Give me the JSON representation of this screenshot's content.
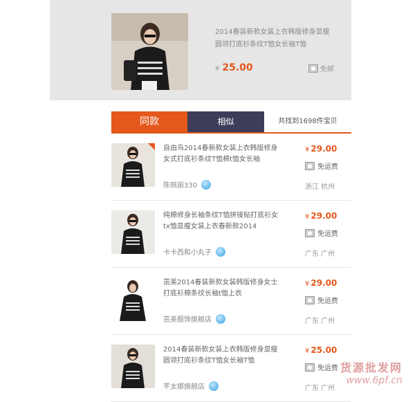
{
  "header": {
    "title": "2014春装新款女装上衣韩版修身显瘦圆领打底衫条纹T恤女长袖T恤",
    "price_symbol": "¥",
    "price": "25.00",
    "shipping": "免邮"
  },
  "tabs": {
    "same_label": "同款",
    "similar_label": "相似",
    "count_text": "共找到1698件宝贝"
  },
  "items": [
    {
      "desc": "自由鸟2014春新款女装上衣韩版修身女式打底衫条纹T恤棉t恤女长袖",
      "seller": "陈佩丽330",
      "price": "29.00",
      "shipping": "免运费",
      "location": "浙江 杭州"
    },
    {
      "desc": "纯棉修身长袖条纹T恤拼接贴打底衫女tx恤显瘦女装上衣春新款2014",
      "seller": "卡卡西和小丸子",
      "price": "29.00",
      "shipping": "免运费",
      "location": "广东 广州"
    },
    {
      "desc": "茁美2014春装新款女装韩版修身女士打底衫棉条纹长袖t恤上衣",
      "seller": "茁美服饰旗舰店",
      "price": "29.00",
      "shipping": "免运费",
      "location": "广东 广州"
    },
    {
      "desc": "2014春装新款女装上衣韩版修身显瘦圆领打底衫条纹T恤女长袖T恤",
      "seller": "芊太娜旗舰店",
      "price": "25.00",
      "shipping": "免运费",
      "location": "广东 广州"
    }
  ],
  "watermark": {
    "title": "货源批发网",
    "url": "www.6pf.cn"
  },
  "colors": {
    "accent": "#e4581c",
    "tab_dark": "#3d3d5a",
    "header_bg": "#e6e6e6"
  }
}
